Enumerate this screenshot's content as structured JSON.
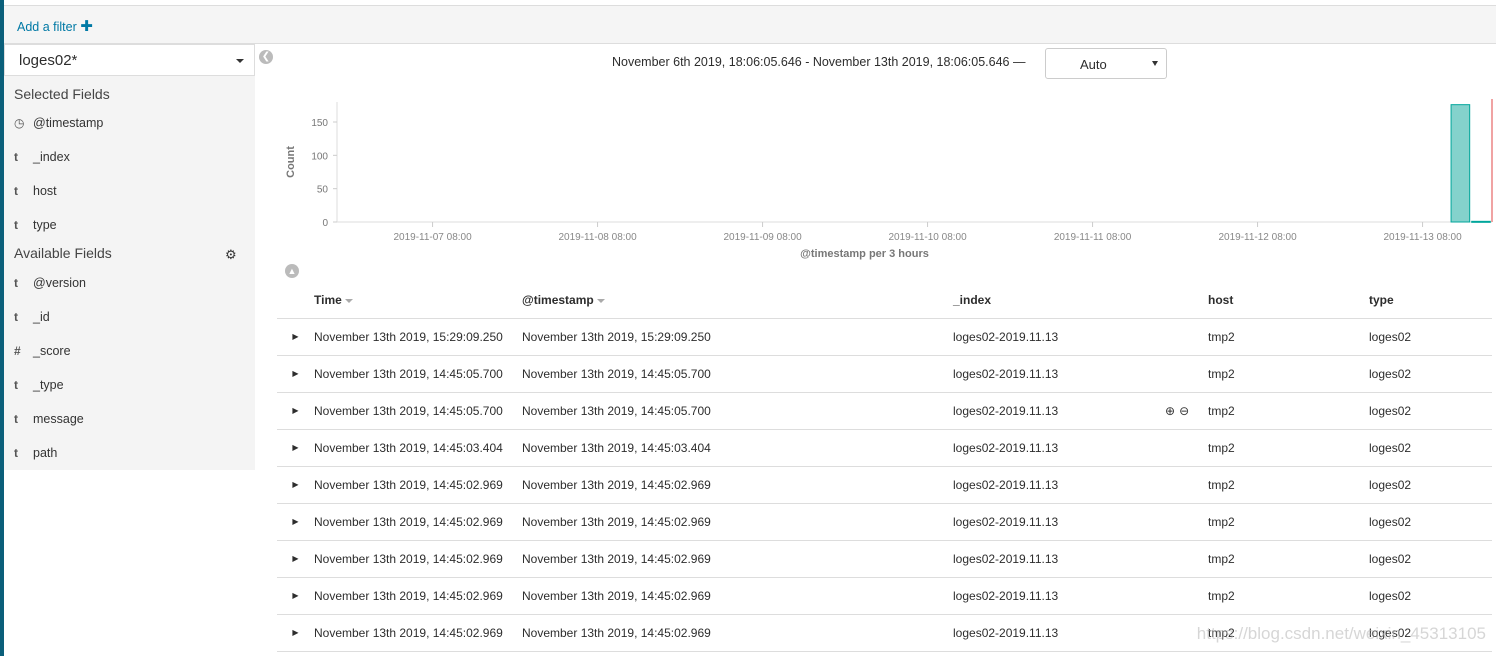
{
  "filter": {
    "add_label": "Add a filter",
    "plus_icon": "plus-icon"
  },
  "sidebar": {
    "index_pattern": "loges02*",
    "selected_title": "Selected Fields",
    "selected": [
      {
        "type": "clock",
        "label": "@timestamp"
      },
      {
        "type": "t",
        "label": "_index"
      },
      {
        "type": "t",
        "label": "host"
      },
      {
        "type": "t",
        "label": "type"
      }
    ],
    "available_title": "Available Fields",
    "available": [
      {
        "type": "t",
        "label": "@version"
      },
      {
        "type": "t",
        "label": "_id"
      },
      {
        "type": "#",
        "label": "_score"
      },
      {
        "type": "t",
        "label": "_type"
      },
      {
        "type": "t",
        "label": "message"
      },
      {
        "type": "t",
        "label": "path"
      }
    ]
  },
  "header": {
    "time_range": "November 6th 2019, 18:06:05.646 - November 13th 2019, 18:06:05.646 —",
    "interval": "Auto"
  },
  "chart_data": {
    "type": "bar",
    "ylabel": "Count",
    "xlabel": "@timestamp per 3 hours",
    "ylim": [
      0,
      180
    ],
    "yticks": [
      0,
      50,
      100,
      150
    ],
    "xticks": [
      "2019-11-07 08:00",
      "2019-11-08 08:00",
      "2019-11-09 08:00",
      "2019-11-10 08:00",
      "2019-11-11 08:00",
      "2019-11-12 08:00",
      "2019-11-13 08:00"
    ],
    "xrange": [
      "2019-11-06 18:06",
      "2019-11-13 18:06"
    ],
    "bars": [
      {
        "x": "2019-11-13 12:00",
        "value": 176
      },
      {
        "x": "2019-11-13 15:00",
        "value": 1
      }
    ],
    "bar_color": "#84d2cc",
    "bar_stroke": "#00a69b",
    "now_line_color": "#f0a3a3"
  },
  "table": {
    "columns": [
      "Time",
      "@timestamp",
      "_index",
      "host",
      "type"
    ],
    "rows": [
      [
        "November 13th 2019, 15:29:09.250",
        "November 13th 2019, 15:29:09.250",
        "loges02-2019.11.13",
        "tmp2",
        "loges02"
      ],
      [
        "November 13th 2019, 14:45:05.700",
        "November 13th 2019, 14:45:05.700",
        "loges02-2019.11.13",
        "tmp2",
        "loges02"
      ],
      [
        "November 13th 2019, 14:45:05.700",
        "November 13th 2019, 14:45:05.700",
        "loges02-2019.11.13",
        "tmp2",
        "loges02"
      ],
      [
        "November 13th 2019, 14:45:03.404",
        "November 13th 2019, 14:45:03.404",
        "loges02-2019.11.13",
        "tmp2",
        "loges02"
      ],
      [
        "November 13th 2019, 14:45:02.969",
        "November 13th 2019, 14:45:02.969",
        "loges02-2019.11.13",
        "tmp2",
        "loges02"
      ],
      [
        "November 13th 2019, 14:45:02.969",
        "November 13th 2019, 14:45:02.969",
        "loges02-2019.11.13",
        "tmp2",
        "loges02"
      ],
      [
        "November 13th 2019, 14:45:02.969",
        "November 13th 2019, 14:45:02.969",
        "loges02-2019.11.13",
        "tmp2",
        "loges02"
      ],
      [
        "November 13th 2019, 14:45:02.969",
        "November 13th 2019, 14:45:02.969",
        "loges02-2019.11.13",
        "tmp2",
        "loges02"
      ],
      [
        "November 13th 2019, 14:45:02.969",
        "November 13th 2019, 14:45:02.969",
        "loges02-2019.11.13",
        "tmp2",
        "loges02"
      ]
    ]
  },
  "watermark": "https://blog.csdn.net/weixin_45313105"
}
